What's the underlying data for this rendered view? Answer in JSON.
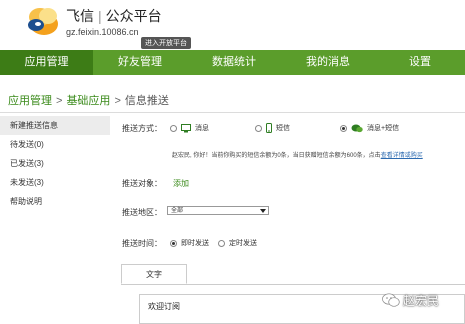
{
  "header": {
    "brand_name": "飞信",
    "brand_separator": "|",
    "brand_platform": "公众平台",
    "domain": "gz.feixin.10086.cn",
    "dev_mode_tag": "进入开放平台"
  },
  "nav": {
    "items": [
      {
        "label": "应用管理",
        "active": true
      },
      {
        "label": "好友管理",
        "active": false
      },
      {
        "label": "数据统计",
        "active": false
      },
      {
        "label": "我的消息",
        "active": false
      },
      {
        "label": "设置",
        "active": false
      }
    ]
  },
  "breadcrumb": {
    "items": [
      "应用管理",
      "基础应用",
      "信息推送"
    ],
    "separator": ">"
  },
  "sidebar": {
    "items": [
      {
        "label": "新建推送信息",
        "active": true
      },
      {
        "label": "待发送(0)",
        "active": false
      },
      {
        "label": "已发送(3)",
        "active": false
      },
      {
        "label": "未发送(3)",
        "active": false
      },
      {
        "label": "帮助说明",
        "active": false
      }
    ]
  },
  "form": {
    "push_method": {
      "label": "推送方式：",
      "options": [
        {
          "label": "消息",
          "icon": "monitor-icon",
          "selected": false
        },
        {
          "label": "短信",
          "icon": "phone-icon",
          "selected": false
        },
        {
          "label": "消息+短信",
          "icon": "chat-icon",
          "selected": true
        }
      ]
    },
    "notice": {
      "text": "赵宏民, 你好！当前你购买的短信余额为0条，当日获赠短信余额为600条，点击",
      "link": "查看详情或购买"
    },
    "push_target": {
      "label": "推送对象：",
      "add_link": "添加"
    },
    "push_region": {
      "label": "推送地区：",
      "selected": "全部"
    },
    "push_time": {
      "label": "推送时间：",
      "options": [
        {
          "label": "即时发送",
          "selected": true
        },
        {
          "label": "定时发送",
          "selected": false
        }
      ]
    },
    "tabs": [
      {
        "label": "文字",
        "active": true
      }
    ],
    "editor_content": "欢迎订阅"
  },
  "watermark": {
    "text": "赵宏民",
    "icon": "wechat-icon"
  },
  "colors": {
    "nav_bg": "#5b9d2b",
    "nav_active_bg": "#3d7c16",
    "link_green": "#3a8a1a",
    "link_blue": "#2c6ab0"
  }
}
